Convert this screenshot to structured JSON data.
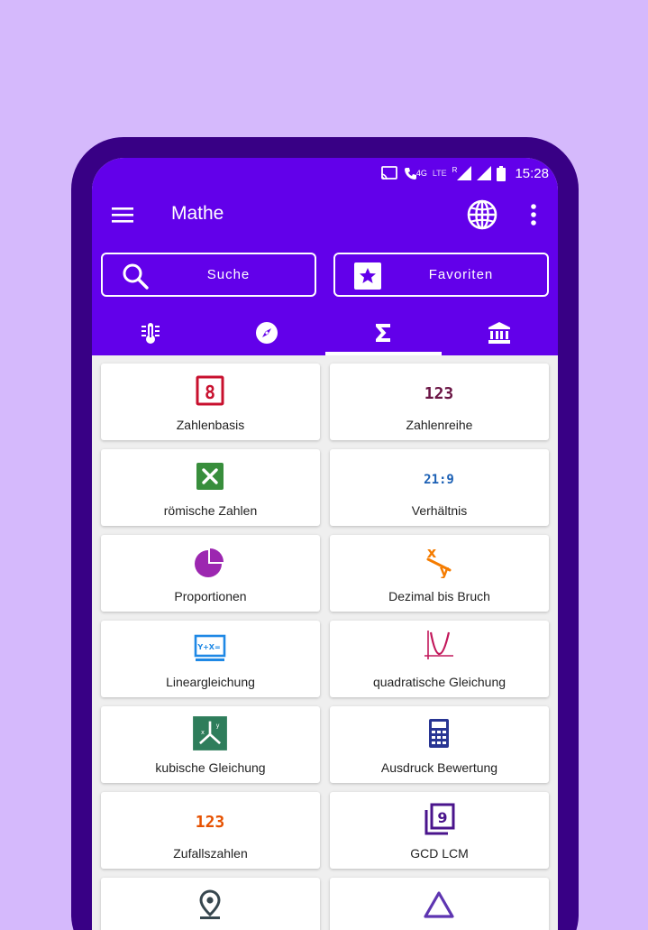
{
  "status_bar": {
    "time": "15:28",
    "network_4g": "4G",
    "network_lte": "LTE",
    "roaming": "R"
  },
  "app": {
    "title": "Mathe"
  },
  "actions": {
    "search_label": "Suche",
    "favorites_label": "Favoriten"
  },
  "tabs": [
    {
      "icon": "thermometer-icon",
      "active": false
    },
    {
      "icon": "compass-icon",
      "active": false
    },
    {
      "icon": "sigma-icon",
      "active": true
    },
    {
      "icon": "bank-icon",
      "active": false
    }
  ],
  "items": [
    {
      "label": "Zahlenbasis",
      "icon": "number-base-icon",
      "color": "#c8102e",
      "glyph": "8"
    },
    {
      "label": "Zahlenreihe",
      "icon": "number-series-icon",
      "color": "#6a1444",
      "glyph": "123"
    },
    {
      "label": "römische Zahlen",
      "icon": "roman-numerals-icon",
      "color": "#388e3c"
    },
    {
      "label": "Verhältnis",
      "icon": "ratio-icon",
      "color": "#1a5fb4",
      "glyph": "21:9"
    },
    {
      "label": "Proportionen",
      "icon": "pie-chart-icon",
      "color": "#9c27b0"
    },
    {
      "label": "Dezimal bis Bruch",
      "icon": "fraction-icon",
      "color": "#f57c00"
    },
    {
      "label": "Lineargleichung",
      "icon": "linear-equation-icon",
      "color": "#1e88e5",
      "glyph": "Y+X="
    },
    {
      "label": "quadratische Gleichung",
      "icon": "parabola-icon",
      "color": "#c2185b"
    },
    {
      "label": "kubische Gleichung",
      "icon": "cubic-equation-icon",
      "color": "#2e7d5b"
    },
    {
      "label": "Ausdruck Bewertung",
      "icon": "calculator-icon",
      "color": "#283593"
    },
    {
      "label": "Zufallszahlen",
      "icon": "random-numbers-icon",
      "color": "#e65100",
      "glyph": "123"
    },
    {
      "label": "GCD LCM",
      "icon": "gcd-lcm-icon",
      "color": "#4a148c",
      "glyph": "9"
    },
    {
      "label": "",
      "icon": "location-pin-icon",
      "color": "#37474f"
    },
    {
      "label": "",
      "icon": "triangle-icon",
      "color": "#5e35b1"
    }
  ],
  "colors": {
    "background": "#d5b9fc",
    "phone_frame": "#380085",
    "primary": "#6200ea",
    "screen_bg": "#efefef"
  }
}
